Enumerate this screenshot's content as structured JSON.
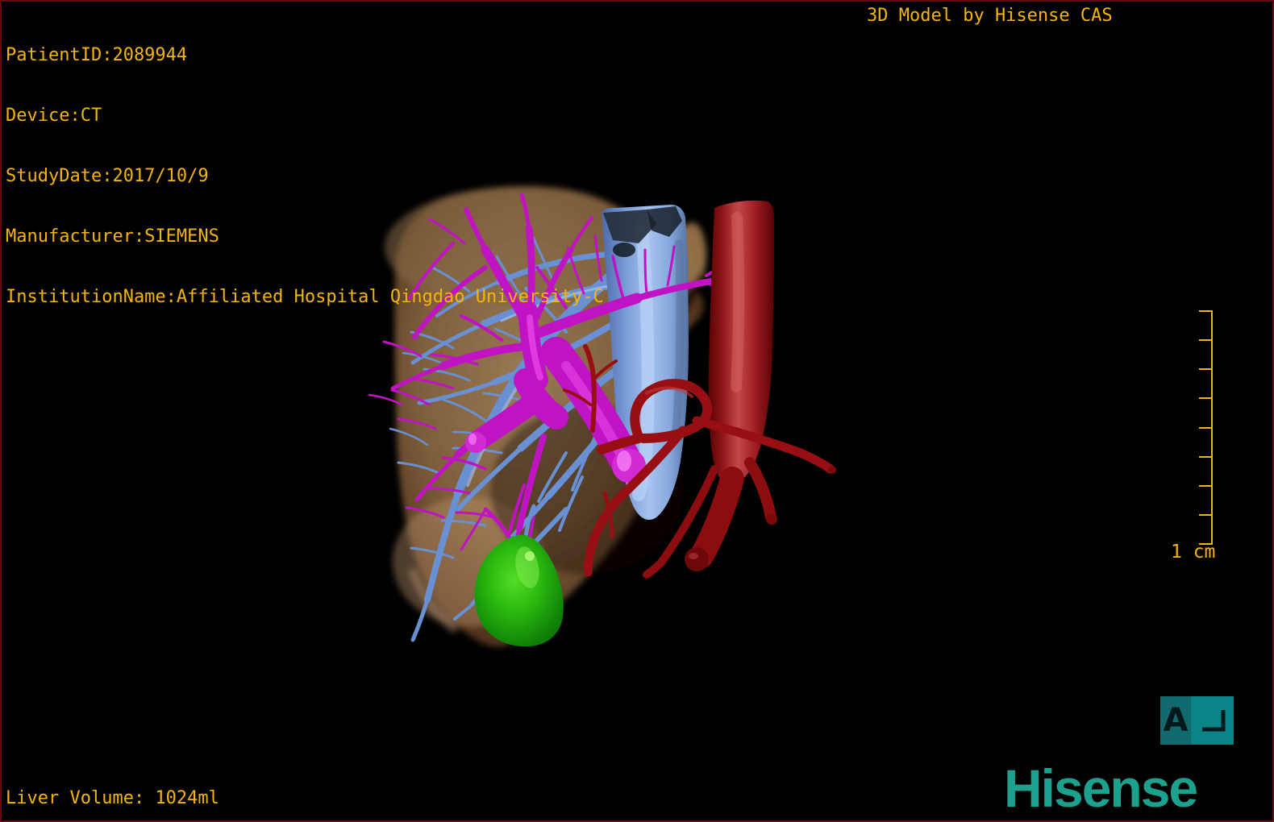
{
  "app": {
    "watermark": "3D Model by Hisense CAS",
    "brand": "Hisense"
  },
  "patient_info": {
    "lines": [
      "PatientID:2089944",
      "Device:CT",
      "StudyDate:2017/10/9",
      "Manufacturer:SIEMENS",
      "InstitutionName:Affiliated Hospital Qingdao University-C"
    ]
  },
  "measurements": {
    "liver_volume": "Liver Volume: 1024ml"
  },
  "scale_bar": {
    "label": "1 cm",
    "tick_count": 9
  },
  "orientation_marker": {
    "letter": "A"
  },
  "model": {
    "structures": [
      {
        "name": "liver",
        "color": "#9a7a53"
      },
      {
        "name": "hepatic-veins-ivc",
        "color": "#7fa4e0"
      },
      {
        "name": "portal-vein",
        "color": "#c013c4"
      },
      {
        "name": "aorta-hepatic-artery",
        "color": "#9a0e12"
      },
      {
        "name": "gallbladder",
        "color": "#1ea80e"
      }
    ]
  },
  "colors": {
    "text_yellow": "#f3b40e",
    "brand_teal": "#1da18f",
    "border_red": "#620b11",
    "marker_teal_left": "#106a6e",
    "marker_teal_right": "#0a8486",
    "background": "#000000"
  }
}
